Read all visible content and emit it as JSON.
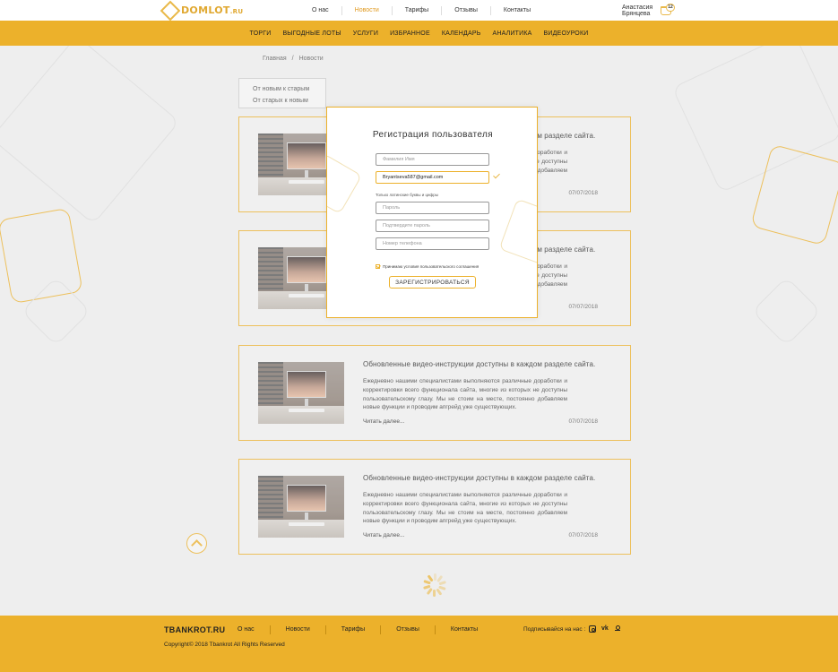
{
  "header": {
    "logo": {
      "main": "DOMLOT",
      "suffix": ".RU"
    },
    "nav": [
      "О нас",
      "Новости",
      "Тарифы",
      "Отзывы",
      "Контакты"
    ],
    "nav_active": 1,
    "user": {
      "first_name": "Анастасия",
      "last_name": "Брянцева"
    },
    "cart_count": "12"
  },
  "menu": [
    "Торги",
    "Выгодные  лоты",
    "Услуги",
    "Избранное",
    "Календарь",
    "Аналитика",
    "Видеоуроки"
  ],
  "breadcrumb": {
    "home": "Главная",
    "separator": "/",
    "current": "Новости"
  },
  "sort": {
    "newest": "От новым к старым",
    "oldest": "От старых к новым"
  },
  "news": [
    {
      "title": "Обновленные видео-инструкции доступны в каждом разделе сайта.",
      "text": "Ежедневно нашими специалистами выполняются различные доработки и корректировки всего функционала сайта, многие из которых не доступны пользовательскому глазу. Мы не стоим на месте, постоянно добавляем новые функции и проводим апгрейд уже существующих.",
      "more": "Читать далее...",
      "date": "07/07/2018"
    },
    {
      "title": "Обновленные видео-инструкции доступны в каждом разделе сайта.",
      "text": "Ежедневно нашими специалистами выполняются различные доработки и корректировки всего функционала сайта, многие из которых не доступны пользовательскому глазу. Мы не стоим на месте, постоянно добавляем новые функции и проводим апгрейд уже существующих.",
      "more": "Читать далее...",
      "date": "07/07/2018"
    },
    {
      "title": "Обновленные видео-инструкции доступны в каждом разделе сайта.",
      "text": "Ежедневно нашими специалистами выполняются различные доработки и корректировки всего функционала сайта, многие из которых не доступны пользовательскому глазу. Мы не стоим на месте, постоянно добавляем новые функции и проводим апгрейд уже существующих.",
      "more": "Читать далее...",
      "date": "07/07/2018"
    },
    {
      "title": "Обновленные видео-инструкции доступны в каждом разделе сайта.",
      "text": "Ежедневно нашими специалистами выполняются различные доработки и корректировки всего функционала сайта, многие из которых не доступны пользовательскому глазу. Мы не стоим на месте, постоянно добавляем новые функции и проводим апгрейд уже существующих.",
      "more": "Читать далее...",
      "date": "07/07/2018"
    }
  ],
  "modal": {
    "title": "Регистрация пользователя",
    "name_placeholder": "Фамилия Имя",
    "email_value": "Bryantseva587@gmail.com",
    "hint": "Только латинские буквы и цифры",
    "password_placeholder": "Пароль",
    "confirm_placeholder": "Подтвердите пароль",
    "phone_placeholder": "Номер телефона",
    "agree_label": "Принимаю условия пользовательского соглашения",
    "submit_label": "Зарегистрироваться"
  },
  "footer": {
    "logo": "TBANKROT.RU",
    "nav": [
      "О нас",
      "Новости",
      "Тарифы",
      "Отзывы",
      "Контакты"
    ],
    "subscribe": "Подписывайся на нас :",
    "social_icons": [
      "instagram-icon",
      "vk-icon",
      "odnoklassniki-icon"
    ],
    "copyright": "Copyright© 2018 Tbankrot All Rights Reserved"
  },
  "colors": {
    "accent": "#ecb12b",
    "background": "#eeeeee",
    "card": "#f1f1f1"
  }
}
